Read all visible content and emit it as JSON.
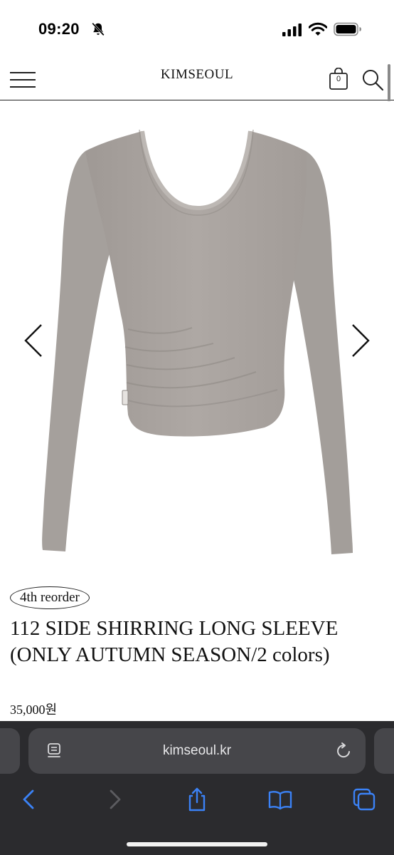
{
  "status_bar": {
    "time": "09:20",
    "icons": [
      "bell-slash-icon",
      "cellular-signal-icon",
      "wifi-icon",
      "battery-icon"
    ]
  },
  "header": {
    "brand": "KIMSEOUL",
    "cart_count": "0",
    "icons": [
      "menu-icon",
      "shopping-bag-icon",
      "search-icon"
    ]
  },
  "product": {
    "badge": "4th reorder",
    "title": "112 SIDE SHIRRING LONG SLEEVE (ONLY AUTUMN SEASON/2 colors)",
    "price": "35,000원",
    "image_alt": "grey square-neck long sleeve top with side shirring",
    "garment_color": "#a9a39f"
  },
  "carousel": {
    "icons": [
      "chevron-left-icon",
      "chevron-right-icon"
    ]
  },
  "browser": {
    "url": "kimseoul.kr",
    "accent": "#3b82f6",
    "icons": [
      "reader-icon",
      "reload-icon",
      "back-icon",
      "forward-icon",
      "share-icon",
      "bookmarks-icon",
      "tabs-icon"
    ]
  }
}
